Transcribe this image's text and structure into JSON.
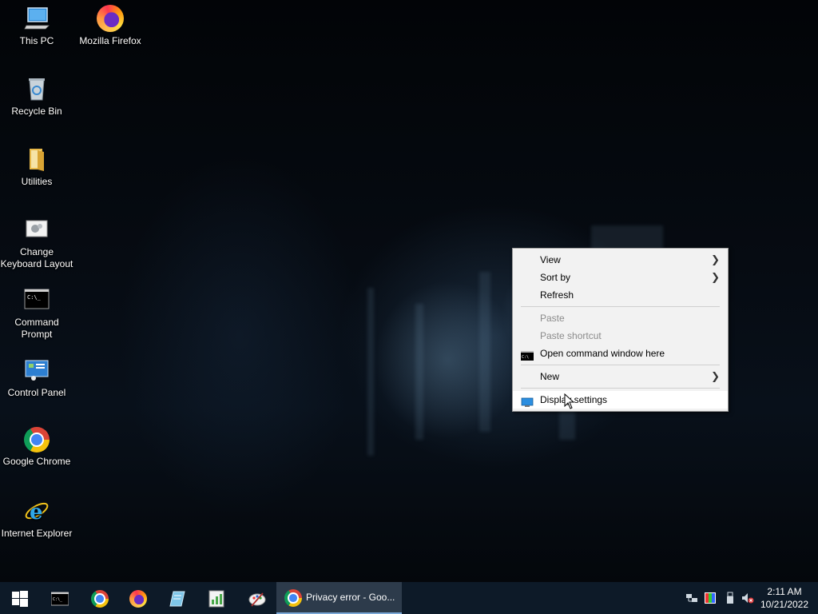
{
  "desktop_icons": [
    {
      "label": "This PC",
      "icon": "this-pc-icon"
    },
    {
      "label": "Mozilla Firefox",
      "icon": "firefox-icon"
    },
    {
      "label": "Recycle Bin",
      "icon": "recycle-bin-icon"
    },
    {
      "label": "Utilities",
      "icon": "folder-icon"
    },
    {
      "label": "Change Keyboard Layout",
      "icon": "keyboard-layout-icon"
    },
    {
      "label": "Command Prompt",
      "icon": "command-prompt-icon"
    },
    {
      "label": "Control Panel",
      "icon": "control-panel-icon"
    },
    {
      "label": "Google Chrome",
      "icon": "chrome-icon"
    },
    {
      "label": "Internet Explorer",
      "icon": "internet-explorer-icon"
    }
  ],
  "context_menu": {
    "view": "View",
    "sort_by": "Sort by",
    "refresh": "Refresh",
    "paste": "Paste",
    "paste_shortcut": "Paste shortcut",
    "open_command_window": "Open command window here",
    "new": "New",
    "display_settings": "Display settings"
  },
  "taskbar": {
    "pinned": [
      "start-icon",
      "command-prompt-icon",
      "chrome-icon",
      "firefox-icon",
      "notepad-icon",
      "spreadsheet-icon",
      "paint-icon"
    ],
    "active_window_title": "Privacy error - Goo...",
    "clock_time": "2:11 AM",
    "clock_date": "10/21/2022"
  },
  "colors": {
    "taskbar": "#0d1a28",
    "menu_bg": "#f2f2f2",
    "menu_disabled_text": "#8b8b8b",
    "active_task_underline": "#7aa7d6"
  }
}
